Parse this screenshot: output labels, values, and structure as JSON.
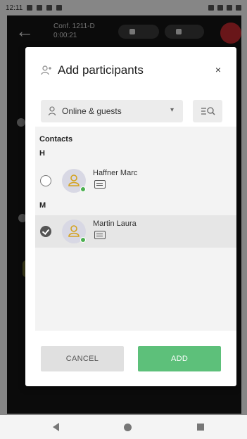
{
  "status_bar": {
    "time": "12:11"
  },
  "call": {
    "title": "Conf. 1211-D",
    "duration": "0:00:21"
  },
  "dialog": {
    "title": "Add participants",
    "close_glyph": "×",
    "filter": {
      "selected": "Online & guests"
    },
    "contacts_heading": "Contacts",
    "groups": [
      {
        "letter": "H",
        "contacts": [
          {
            "name": "Haffner Marc",
            "selected": false,
            "presence_color": "#4caf50"
          }
        ]
      },
      {
        "letter": "M",
        "contacts": [
          {
            "name": "Martin Laura",
            "selected": true,
            "presence_color": "#4caf50"
          }
        ]
      }
    ],
    "cancel_label": "CANCEL",
    "add_label": "ADD"
  },
  "colors": {
    "accent_green": "#5dc07a",
    "hangup_red": "#c0292f"
  }
}
